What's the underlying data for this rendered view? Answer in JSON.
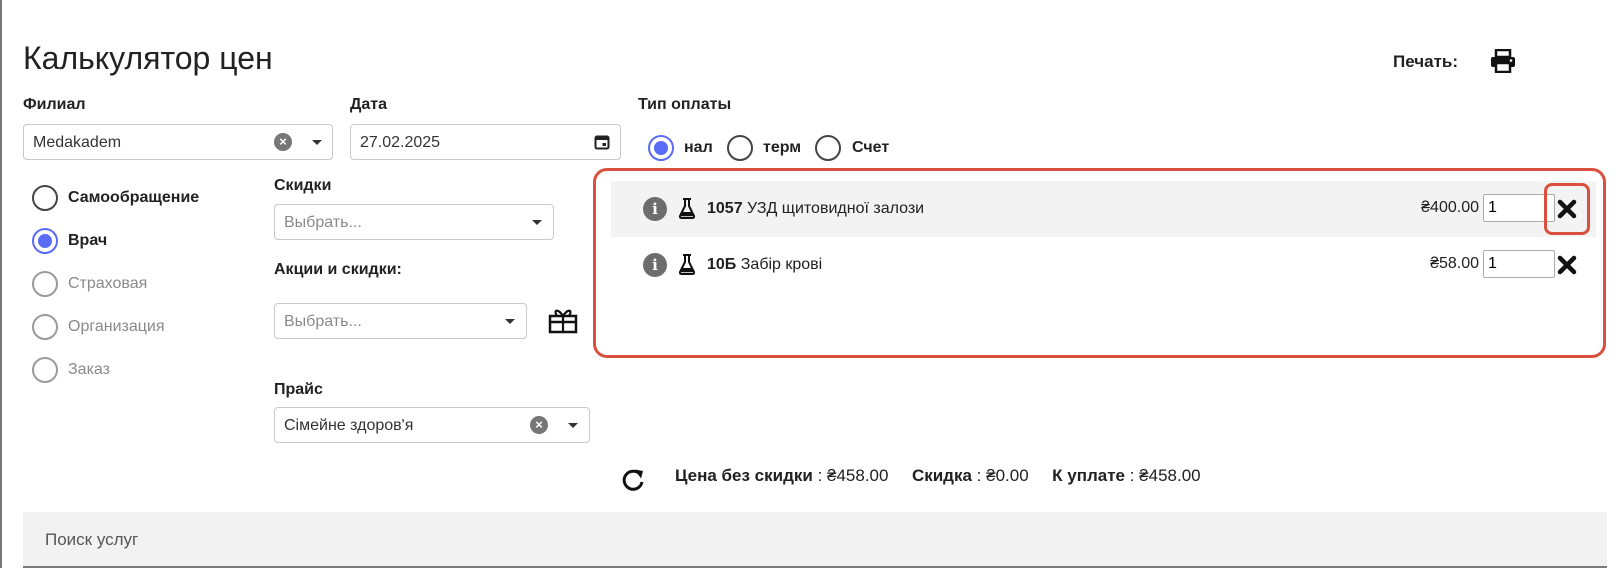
{
  "page": {
    "title": "Калькулятор цен",
    "print_label": "Печать:"
  },
  "branch": {
    "label": "Филиал",
    "value": "Medakadem"
  },
  "date": {
    "label": "Дата",
    "value": "27.02.2025"
  },
  "payment": {
    "label": "Тип оплаты",
    "options": [
      {
        "label": "нал",
        "checked": true
      },
      {
        "label": "терм",
        "checked": false
      },
      {
        "label": "Счет",
        "checked": false
      }
    ]
  },
  "source": {
    "options": [
      {
        "label": "Самообращение",
        "checked": false,
        "disabled": false
      },
      {
        "label": "Врач",
        "checked": true,
        "disabled": false
      },
      {
        "label": "Страховая",
        "checked": false,
        "disabled": true
      },
      {
        "label": "Организация",
        "checked": false,
        "disabled": true
      },
      {
        "label": "Заказ",
        "checked": false,
        "disabled": true
      }
    ]
  },
  "discounts": {
    "label": "Скидки",
    "placeholder": "Выбрать..."
  },
  "promos": {
    "label": "Акции и скидки:",
    "placeholder": "Выбрать..."
  },
  "pricelist": {
    "label": "Прайс",
    "value": "Сімейне здоров'я"
  },
  "cart": {
    "items": [
      {
        "code": "1057",
        "name": "УЗД щитовидної залози",
        "price": "₴400.00",
        "qty": "1"
      },
      {
        "code": "10Б",
        "name": "Забір крові",
        "price": "₴58.00",
        "qty": "1"
      }
    ]
  },
  "totals": {
    "no_discount_label": "Цена без скидки",
    "no_discount_value": ": ₴458.00",
    "discount_label": "Скидка",
    "discount_value": ": ₴0.00",
    "to_pay_label": "К уплате",
    "to_pay_value": ": ₴458.00"
  },
  "search": {
    "placeholder": "Поиск услуг"
  },
  "colors": {
    "accent": "#5a6cf5",
    "highlight": "#d9503f"
  },
  "icons": [
    "printer-icon",
    "calendar-icon",
    "gift-icon",
    "info-icon",
    "flask-icon",
    "close-icon",
    "refresh-icon",
    "clear-icon",
    "chevron-down-icon"
  ]
}
